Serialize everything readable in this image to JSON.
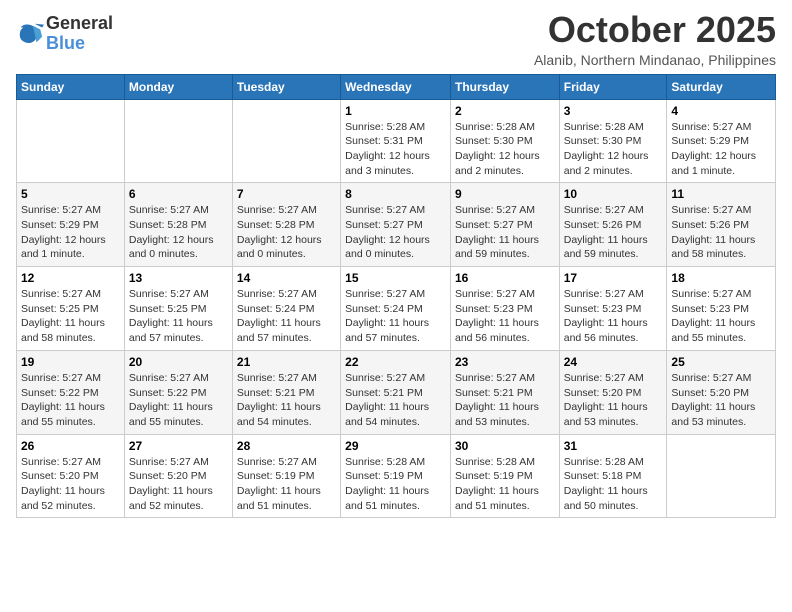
{
  "header": {
    "logo_line1": "General",
    "logo_line2": "Blue",
    "month": "October 2025",
    "location": "Alanib, Northern Mindanao, Philippines"
  },
  "weekdays": [
    "Sunday",
    "Monday",
    "Tuesday",
    "Wednesday",
    "Thursday",
    "Friday",
    "Saturday"
  ],
  "weeks": [
    [
      {
        "day": "",
        "info": ""
      },
      {
        "day": "",
        "info": ""
      },
      {
        "day": "",
        "info": ""
      },
      {
        "day": "1",
        "info": "Sunrise: 5:28 AM\nSunset: 5:31 PM\nDaylight: 12 hours\nand 3 minutes."
      },
      {
        "day": "2",
        "info": "Sunrise: 5:28 AM\nSunset: 5:30 PM\nDaylight: 12 hours\nand 2 minutes."
      },
      {
        "day": "3",
        "info": "Sunrise: 5:28 AM\nSunset: 5:30 PM\nDaylight: 12 hours\nand 2 minutes."
      },
      {
        "day": "4",
        "info": "Sunrise: 5:27 AM\nSunset: 5:29 PM\nDaylight: 12 hours\nand 1 minute."
      }
    ],
    [
      {
        "day": "5",
        "info": "Sunrise: 5:27 AM\nSunset: 5:29 PM\nDaylight: 12 hours\nand 1 minute."
      },
      {
        "day": "6",
        "info": "Sunrise: 5:27 AM\nSunset: 5:28 PM\nDaylight: 12 hours\nand 0 minutes."
      },
      {
        "day": "7",
        "info": "Sunrise: 5:27 AM\nSunset: 5:28 PM\nDaylight: 12 hours\nand 0 minutes."
      },
      {
        "day": "8",
        "info": "Sunrise: 5:27 AM\nSunset: 5:27 PM\nDaylight: 12 hours\nand 0 minutes."
      },
      {
        "day": "9",
        "info": "Sunrise: 5:27 AM\nSunset: 5:27 PM\nDaylight: 11 hours\nand 59 minutes."
      },
      {
        "day": "10",
        "info": "Sunrise: 5:27 AM\nSunset: 5:26 PM\nDaylight: 11 hours\nand 59 minutes."
      },
      {
        "day": "11",
        "info": "Sunrise: 5:27 AM\nSunset: 5:26 PM\nDaylight: 11 hours\nand 58 minutes."
      }
    ],
    [
      {
        "day": "12",
        "info": "Sunrise: 5:27 AM\nSunset: 5:25 PM\nDaylight: 11 hours\nand 58 minutes."
      },
      {
        "day": "13",
        "info": "Sunrise: 5:27 AM\nSunset: 5:25 PM\nDaylight: 11 hours\nand 57 minutes."
      },
      {
        "day": "14",
        "info": "Sunrise: 5:27 AM\nSunset: 5:24 PM\nDaylight: 11 hours\nand 57 minutes."
      },
      {
        "day": "15",
        "info": "Sunrise: 5:27 AM\nSunset: 5:24 PM\nDaylight: 11 hours\nand 57 minutes."
      },
      {
        "day": "16",
        "info": "Sunrise: 5:27 AM\nSunset: 5:23 PM\nDaylight: 11 hours\nand 56 minutes."
      },
      {
        "day": "17",
        "info": "Sunrise: 5:27 AM\nSunset: 5:23 PM\nDaylight: 11 hours\nand 56 minutes."
      },
      {
        "day": "18",
        "info": "Sunrise: 5:27 AM\nSunset: 5:23 PM\nDaylight: 11 hours\nand 55 minutes."
      }
    ],
    [
      {
        "day": "19",
        "info": "Sunrise: 5:27 AM\nSunset: 5:22 PM\nDaylight: 11 hours\nand 55 minutes."
      },
      {
        "day": "20",
        "info": "Sunrise: 5:27 AM\nSunset: 5:22 PM\nDaylight: 11 hours\nand 55 minutes."
      },
      {
        "day": "21",
        "info": "Sunrise: 5:27 AM\nSunset: 5:21 PM\nDaylight: 11 hours\nand 54 minutes."
      },
      {
        "day": "22",
        "info": "Sunrise: 5:27 AM\nSunset: 5:21 PM\nDaylight: 11 hours\nand 54 minutes."
      },
      {
        "day": "23",
        "info": "Sunrise: 5:27 AM\nSunset: 5:21 PM\nDaylight: 11 hours\nand 53 minutes."
      },
      {
        "day": "24",
        "info": "Sunrise: 5:27 AM\nSunset: 5:20 PM\nDaylight: 11 hours\nand 53 minutes."
      },
      {
        "day": "25",
        "info": "Sunrise: 5:27 AM\nSunset: 5:20 PM\nDaylight: 11 hours\nand 53 minutes."
      }
    ],
    [
      {
        "day": "26",
        "info": "Sunrise: 5:27 AM\nSunset: 5:20 PM\nDaylight: 11 hours\nand 52 minutes."
      },
      {
        "day": "27",
        "info": "Sunrise: 5:27 AM\nSunset: 5:20 PM\nDaylight: 11 hours\nand 52 minutes."
      },
      {
        "day": "28",
        "info": "Sunrise: 5:27 AM\nSunset: 5:19 PM\nDaylight: 11 hours\nand 51 minutes."
      },
      {
        "day": "29",
        "info": "Sunrise: 5:28 AM\nSunset: 5:19 PM\nDaylight: 11 hours\nand 51 minutes."
      },
      {
        "day": "30",
        "info": "Sunrise: 5:28 AM\nSunset: 5:19 PM\nDaylight: 11 hours\nand 51 minutes."
      },
      {
        "day": "31",
        "info": "Sunrise: 5:28 AM\nSunset: 5:18 PM\nDaylight: 11 hours\nand 50 minutes."
      },
      {
        "day": "",
        "info": ""
      }
    ]
  ]
}
